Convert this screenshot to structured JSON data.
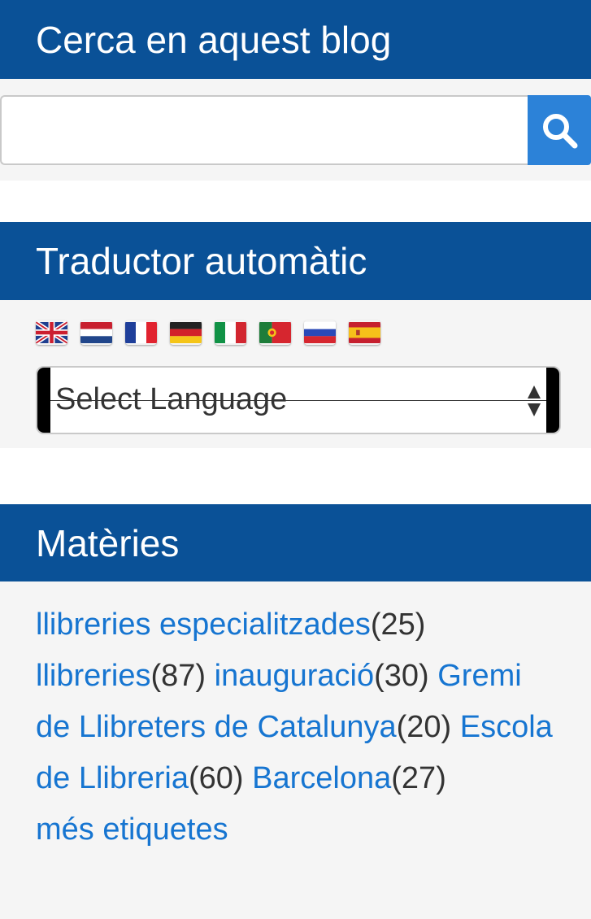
{
  "search": {
    "title": "Cerca en aquest blog",
    "input_value": "",
    "placeholder": ""
  },
  "translator": {
    "title": "Traductor automàtic",
    "flags": [
      "English",
      "Dutch",
      "French",
      "German",
      "Italian",
      "Portuguese",
      "Russian",
      "Spanish"
    ],
    "select_value": "Select Language"
  },
  "topics": {
    "title": "Matèries",
    "tags": [
      {
        "label": "llibreries especialitzades",
        "count": "(25)"
      },
      {
        "label": "llibreries",
        "count": "(87)"
      },
      {
        "label": "inauguració",
        "count": "(30)"
      },
      {
        "label": "Gremi de Llibreters de Catalunya",
        "count": "(20)"
      },
      {
        "label": "Escola de Llibreria",
        "count": "(60)"
      },
      {
        "label": "Barcelona",
        "count": "(27)"
      }
    ],
    "more_label": "més etiquetes"
  },
  "colors": {
    "header_bg": "#0a5197",
    "link": "#1675d1",
    "search_button": "#2c82d8",
    "panel_bg": "#f5f5f5"
  },
  "icons": {
    "search_button": "search-icon",
    "select_arrows": "updown-arrows-icon"
  }
}
